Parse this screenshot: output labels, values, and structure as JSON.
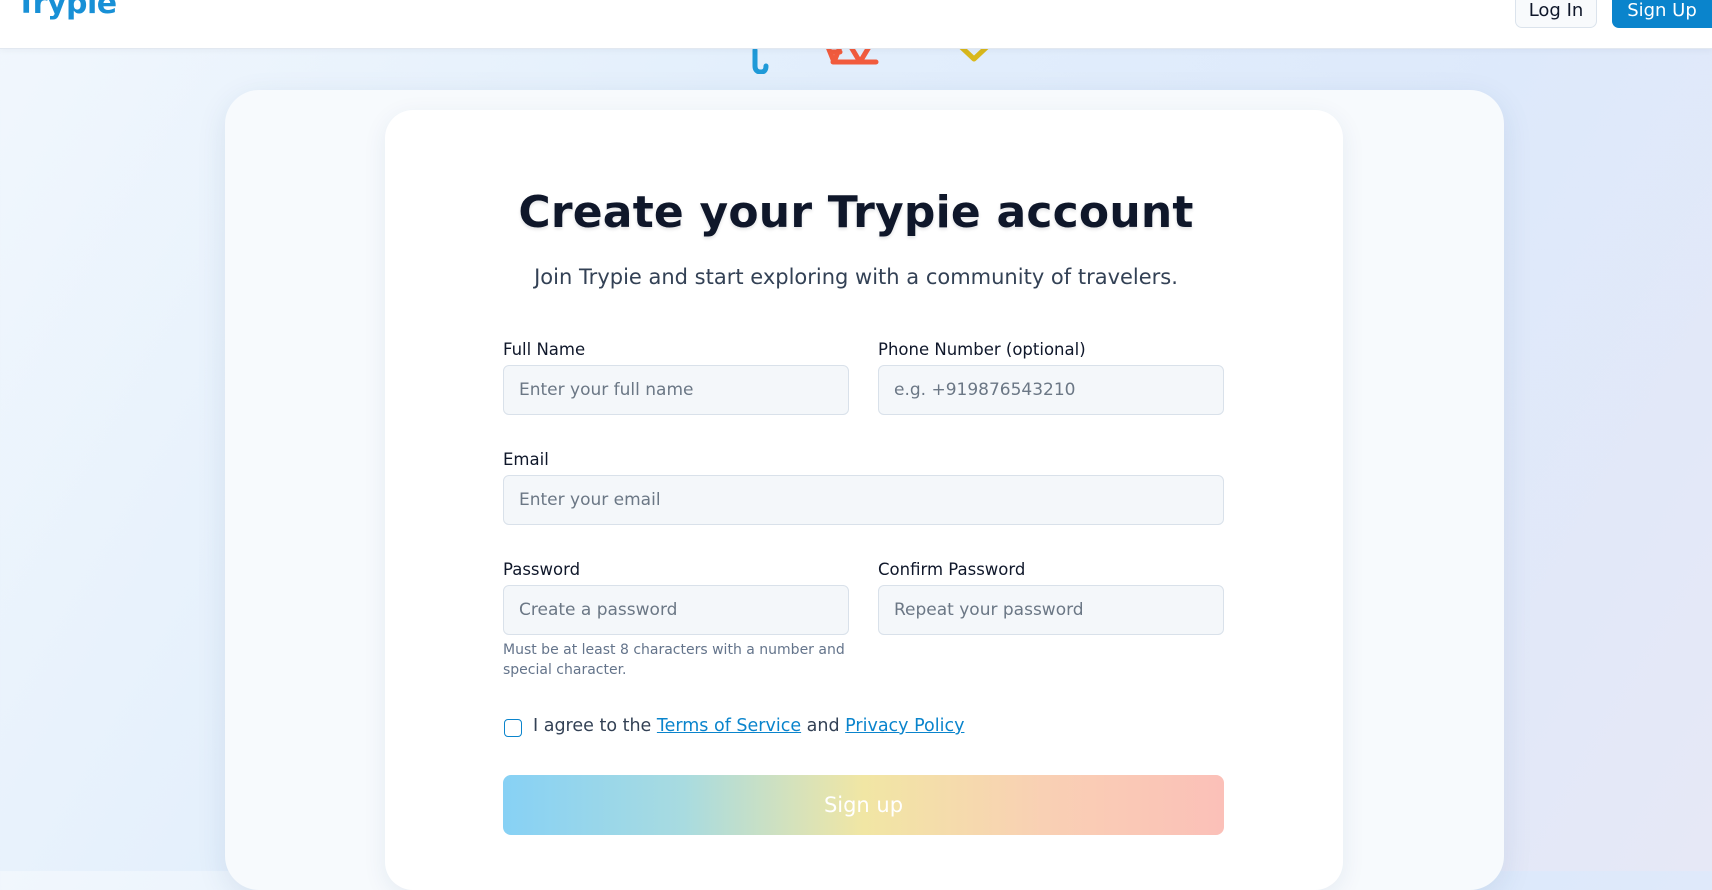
{
  "header": {
    "logo": "Trypie",
    "login_label": "Log In",
    "signup_label": "Sign Up"
  },
  "form": {
    "title": "Create your Trypie account",
    "subtitle": "Join Trypie and start exploring with a community of travelers.",
    "full_name": {
      "label": "Full Name",
      "placeholder": "Enter your full name",
      "value": ""
    },
    "phone": {
      "label": "Phone Number (optional)",
      "placeholder": "e.g. +919876543210",
      "value": ""
    },
    "email": {
      "label": "Email",
      "placeholder": "Enter your email",
      "value": ""
    },
    "password": {
      "label": "Password",
      "placeholder": "Create a password",
      "value": ""
    },
    "confirm_password": {
      "label": "Confirm Password",
      "placeholder": "Repeat your password",
      "value": ""
    },
    "password_hint": "Must be at least 8 characters with a number and special character.",
    "agree": {
      "prefix": "I agree to the ",
      "terms_label": "Terms of Service",
      "middle": " and ",
      "privacy_label": "Privacy Policy",
      "checked": false
    },
    "submit_label": "Sign up"
  },
  "colors": {
    "brand": "#0a84cc",
    "logo": "#1890d6",
    "deco_blue": "#1f9ad8",
    "deco_red": "#f15b3d",
    "deco_yellow": "#d9b81c"
  },
  "decorations": [
    "umbrella-icon",
    "tent-icon",
    "diamond-icon"
  ]
}
